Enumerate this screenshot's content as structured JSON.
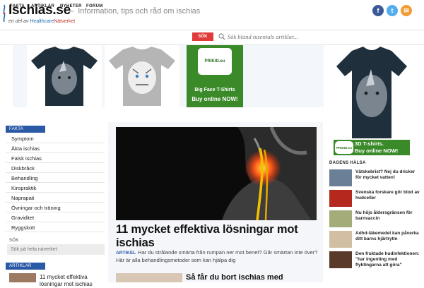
{
  "site": {
    "logo": "Ischias.se",
    "tagline_sep": "–",
    "tagline": "Information, tips och råd om ischias",
    "network_prefix": "en del av",
    "network_healthcare": "Healthcare",
    "network_natverket": "Nätverket"
  },
  "social": {
    "facebook": "f",
    "twitter": "t",
    "mail": "✉"
  },
  "nav": {
    "items": [
      "FAKTA",
      "ARTIKLAR",
      "NYHETER",
      "FORUM"
    ]
  },
  "search": {
    "button": "SÖK",
    "placeholder": "Sök bland tusentals artiklar..."
  },
  "ads": {
    "brand": "PRIKID.eu",
    "line1": "Big Face T-Shirts",
    "line2": "Buy online NOW!",
    "right_line1": "3D T-shirts.",
    "right_line2": "Buy online NOW!"
  },
  "sidebar": {
    "fakta_header": "FAKTA",
    "fakta_items": [
      "Symptom",
      "Äkta ischias",
      "Falsk ischias",
      "Diskbråck",
      "Behandling",
      "Kiropraktik",
      "Naprapati",
      "Övningar och träning",
      "Graviditet",
      "Ryggskott"
    ],
    "search_label": "SÖK",
    "search_placeholder": "Sök på hela nåverket",
    "artiklar_header": "ARTIKLAR",
    "artiklar_item": "11 mycket effektiva lösningar mot ischias"
  },
  "main": {
    "headline": "11 mycket effektiva lösningar mot ischias",
    "tag": "ARTIKEL",
    "excerpt": "Har du strålande smärta från rumpan ner mot benet? Går smärtan inte över? Här är alla behandlingsmetoder som kan hjälpa dig",
    "second_title": "Så får du bort ischias med"
  },
  "dagens_halsa": {
    "header": "DAGENS HÄLSA",
    "items": [
      "Vätskebrist? Nej du dricker för mycket vatten!",
      "Svenska forskare gör blod av hudceller",
      "Nu höjs åldersgränsen för barnvaccin",
      "Adhd-läkemedel kan påverka ditt barns hjärtrytm",
      "Den fruktade hudinfektionen: \"har ingenting med flyktingarna att göra\""
    ]
  },
  "colors": {
    "accent_blue": "#2a5aa6",
    "search_red": "#e03a3a",
    "ad_green": "#3b8a2a"
  }
}
